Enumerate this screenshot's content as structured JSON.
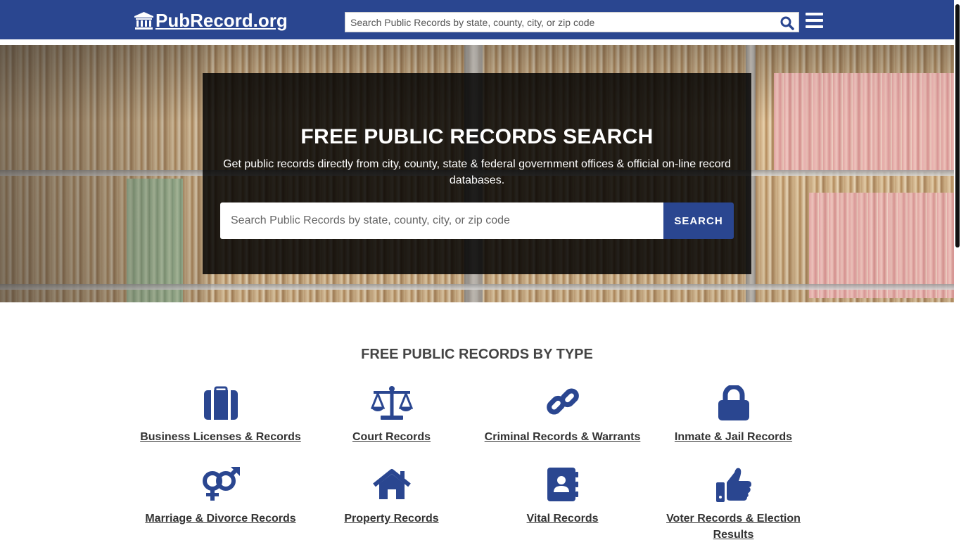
{
  "header": {
    "logo_text": "PubRecord.org",
    "search_placeholder": "Search Public Records by state, county, city, or zip code"
  },
  "hero": {
    "title": "FREE PUBLIC RECORDS SEARCH",
    "subtitle": "Get public records directly from city, county, state & federal government offices & official on-line record databases.",
    "search_placeholder": "Search Public Records by state, county, city, or zip code",
    "search_button": "SEARCH"
  },
  "records_by_type": {
    "title": "FREE PUBLIC RECORDS BY TYPE",
    "items": [
      {
        "label": "Business Licenses & Records",
        "icon": "briefcase-icon"
      },
      {
        "label": "Court Records",
        "icon": "balance-scale-icon"
      },
      {
        "label": "Criminal Records & Warrants",
        "icon": "link-icon"
      },
      {
        "label": "Inmate & Jail Records",
        "icon": "lock-icon"
      },
      {
        "label": "Marriage & Divorce Records",
        "icon": "venus-mars-icon"
      },
      {
        "label": "Property Records",
        "icon": "home-icon"
      },
      {
        "label": "Vital Records",
        "icon": "address-book-icon"
      },
      {
        "label": "Voter Records & Election Results",
        "icon": "thumbs-up-icon"
      }
    ]
  },
  "colors": {
    "brand": "#2a4690",
    "hero_overlay": "#000000"
  }
}
